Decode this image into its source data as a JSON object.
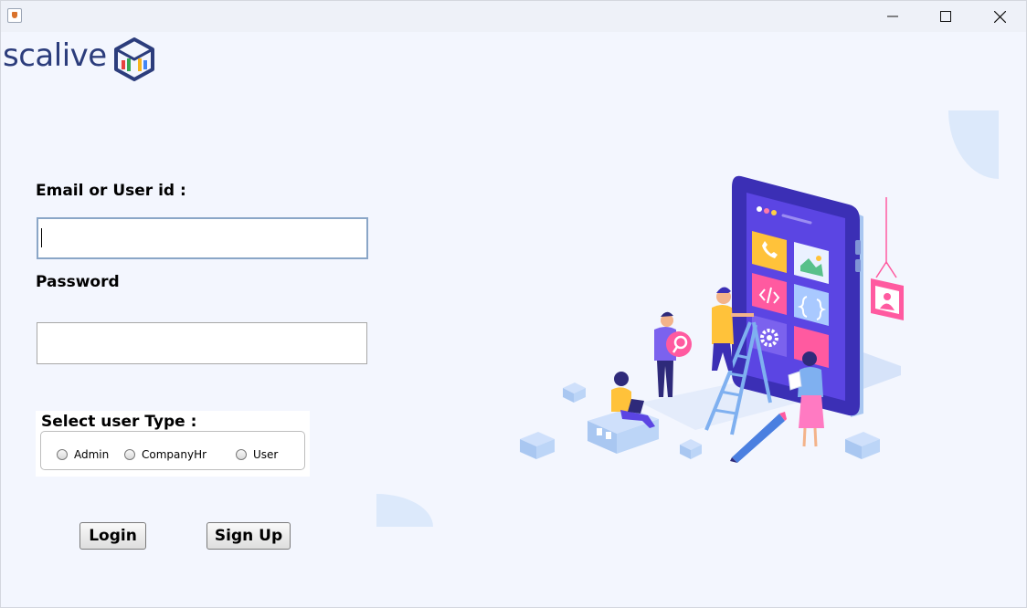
{
  "window": {
    "controls": {
      "minimize_icon": "minimize-icon",
      "maximize_icon": "maximize-icon",
      "close_icon": "close-icon"
    }
  },
  "brand": {
    "name": "scalive",
    "logo_icon": "isometric-cube-logo-icon",
    "colors": [
      "#2c3d7c",
      "#e8423f",
      "#36a852",
      "#f6b51e",
      "#4285f4"
    ]
  },
  "form": {
    "email_label": "Email or User id :",
    "email_value": "",
    "password_label": "Password",
    "password_value": "",
    "user_type": {
      "title": "Select user Type :",
      "options": [
        "Admin",
        "CompanyHr",
        "User"
      ],
      "selected": null
    },
    "login_label": "Login",
    "signup_label": "Sign Up"
  },
  "theme": {
    "background": "#f3f6fe",
    "input_focus_border": "#8aa6c7",
    "illustration_accent": "#6a3de8"
  }
}
